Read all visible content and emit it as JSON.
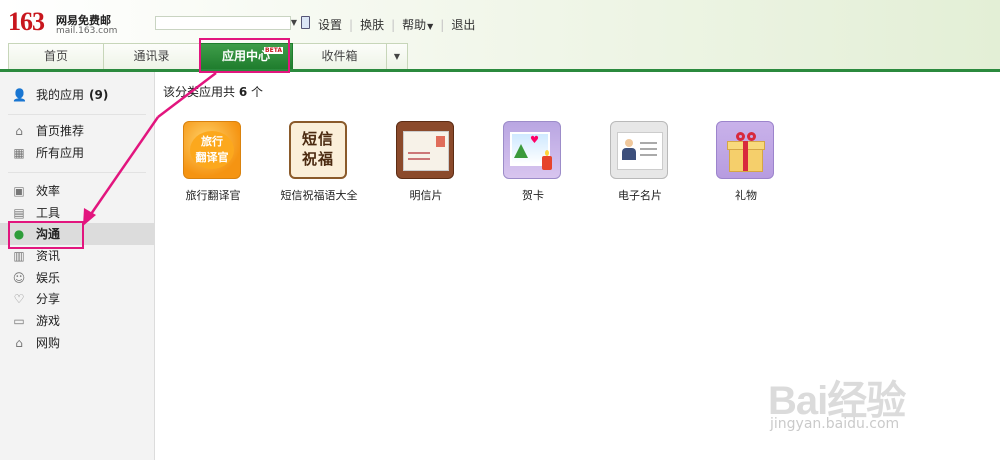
{
  "header": {
    "logo_number": "163",
    "logo_title": "网易免费邮",
    "logo_domain": "mail.163.com",
    "links": [
      {
        "label": "设置"
      },
      {
        "label": "换肤"
      },
      {
        "label": "帮助"
      },
      {
        "label": "退出"
      }
    ]
  },
  "tabs": [
    {
      "label": "首页"
    },
    {
      "label": "通讯录"
    },
    {
      "label": "应用中心",
      "badge": "BETA"
    },
    {
      "label": "收件箱"
    }
  ],
  "sidebar": {
    "my_apps": {
      "label": "我的应用",
      "count": "(9)"
    },
    "items": [
      {
        "label": "首页推荐",
        "icon": "home-icon"
      },
      {
        "label": "所有应用",
        "icon": "grid-icon"
      },
      {
        "label": "效率",
        "icon": "briefcase-icon"
      },
      {
        "label": "工具",
        "icon": "tool-icon"
      },
      {
        "label": "沟通",
        "icon": "chat-bubble-icon"
      },
      {
        "label": "资讯",
        "icon": "news-icon"
      },
      {
        "label": "娱乐",
        "icon": "smiley-icon"
      },
      {
        "label": "分享",
        "icon": "heart-icon"
      },
      {
        "label": "游戏",
        "icon": "gamepad-icon"
      },
      {
        "label": "网购",
        "icon": "shopping-bag-icon"
      }
    ],
    "active": "沟通"
  },
  "main": {
    "count_prefix": "该分类应用共",
    "count_value": "6",
    "count_suffix": "个",
    "apps": [
      {
        "name": "旅行翻译官",
        "icon_text": "旅行翻译官"
      },
      {
        "name": "短信祝福语大全",
        "icon_text": "短信祝福"
      },
      {
        "name": "明信片"
      },
      {
        "name": "贺卡"
      },
      {
        "name": "电子名片"
      },
      {
        "name": "礼物"
      }
    ]
  },
  "watermark": {
    "brand": "Bai经验",
    "url": "jingyan.baidu.com"
  },
  "colors": {
    "brand_red": "#c8161d",
    "tab_green": "#2b8a3e",
    "annotation_pink": "#e2157e"
  }
}
